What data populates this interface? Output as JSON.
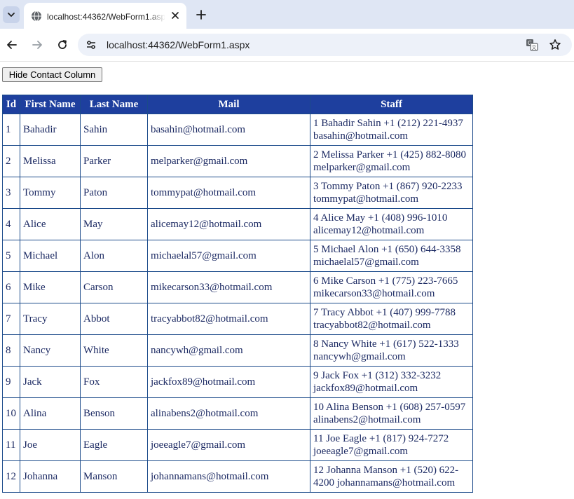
{
  "browser": {
    "tab_title": "localhost:44362/WebForm1.aspx",
    "url": "localhost:44362/WebForm1.aspx"
  },
  "page": {
    "hide_button_label": "Hide Contact Column"
  },
  "table": {
    "headers": {
      "id": "Id",
      "first": "First Name",
      "last": "Last Name",
      "mail": "Mail",
      "staff": "Staff"
    },
    "rows": [
      {
        "id": "1",
        "first": "Bahadir",
        "last": "Sahin",
        "mail": "basahin@hotmail.com",
        "staff": "1 Bahadir Sahin +1 (212) 221-4937 basahin@hotmail.com"
      },
      {
        "id": "2",
        "first": "Melissa",
        "last": "Parker",
        "mail": "melparker@gmail.com",
        "staff": "2 Melissa Parker +1 (425) 882-8080 melparker@gmail.com"
      },
      {
        "id": "3",
        "first": "Tommy",
        "last": "Paton",
        "mail": "tommypat@hotmail.com",
        "staff": "3 Tommy Paton +1 (867) 920-2233 tommypat@hotmail.com"
      },
      {
        "id": "4",
        "first": "Alice",
        "last": "May",
        "mail": "alicemay12@hotmail.com",
        "staff": "4 Alice May +1 (408) 996-1010 alicemay12@hotmail.com"
      },
      {
        "id": "5",
        "first": "Michael",
        "last": "Alon",
        "mail": "michaelal57@gmail.com",
        "staff": "5 Michael Alon +1 (650) 644-3358 michaelal57@gmail.com"
      },
      {
        "id": "6",
        "first": "Mike",
        "last": "Carson",
        "mail": "mikecarson33@hotmail.com",
        "staff": "6 Mike Carson +1 (775) 223-7665 mikecarson33@hotmail.com"
      },
      {
        "id": "7",
        "first": "Tracy",
        "last": "Abbot",
        "mail": "tracyabbot82@hotmail.com",
        "staff": "7 Tracy Abbot +1 (407) 999-7788 tracyabbot82@hotmail.com"
      },
      {
        "id": "8",
        "first": "Nancy",
        "last": "White",
        "mail": "nancywh@gmail.com",
        "staff": "8 Nancy White +1 (617) 522-1333 nancywh@gmail.com"
      },
      {
        "id": "9",
        "first": "Jack",
        "last": "Fox",
        "mail": "jackfox89@hotmail.com",
        "staff": "9 Jack Fox +1 (312) 332-3232 jackfox89@hotmail.com"
      },
      {
        "id": "10",
        "first": "Alina",
        "last": "Benson",
        "mail": "alinabens2@hotmail.com",
        "staff": "10 Alina Benson +1 (608) 257-0597 alinabens2@hotmail.com"
      },
      {
        "id": "11",
        "first": "Joe",
        "last": "Eagle",
        "mail": "joeeagle7@gmail.com",
        "staff": "11 Joe Eagle +1 (817) 924-7272 joeeagle7@gmail.com"
      },
      {
        "id": "12",
        "first": "Johanna",
        "last": "Manson",
        "mail": "johannamans@hotmail.com",
        "staff": "12 Johanna Manson +1 (520) 622-4200 johannamans@hotmail.com"
      }
    ]
  }
}
